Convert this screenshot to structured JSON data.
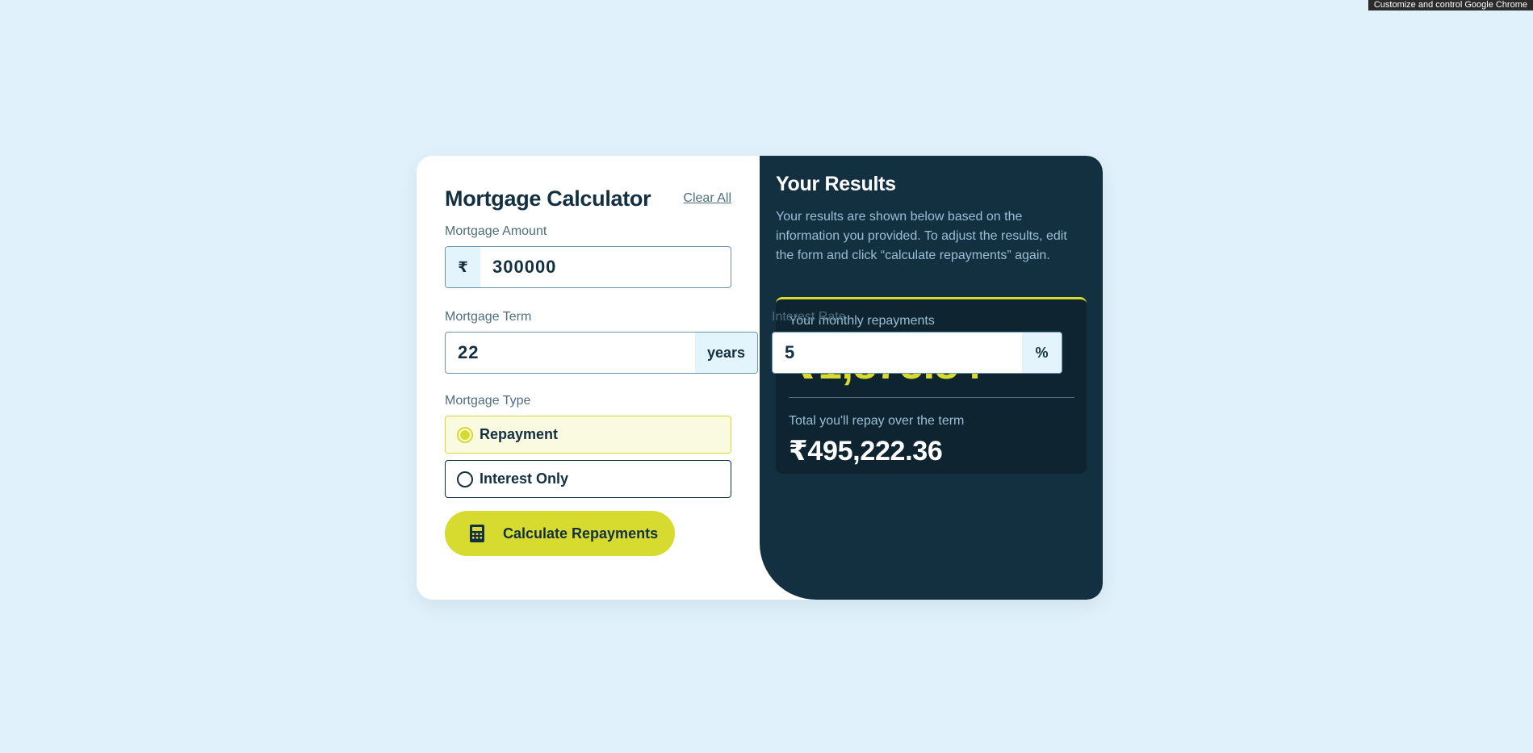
{
  "browser": {
    "tooltip": "Customize and control Google Chrome"
  },
  "form": {
    "title": "Mortgage Calculator",
    "clear_all": "Clear All",
    "amount": {
      "label": "Mortgage Amount",
      "prefix": "₹",
      "value": "300000"
    },
    "term": {
      "label": "Mortgage Term",
      "value": "22",
      "suffix": "years"
    },
    "rate": {
      "label": "Interest Rate",
      "value": "5",
      "suffix": "%"
    },
    "type": {
      "label": "Mortgage Type",
      "options": [
        {
          "label": "Repayment",
          "selected": true
        },
        {
          "label": "Interest Only",
          "selected": false
        }
      ]
    },
    "submit_label": "Calculate Repayments",
    "submit_icon": "calculator-icon"
  },
  "results": {
    "title": "Your Results",
    "description": "Your results are shown below based on the information you provided. To adjust the results, edit the form and click “calculate repayments” again.",
    "monthly_label": "Your monthly repayments",
    "monthly_value": "₹1,875.84",
    "total_label": "Total you'll repay over the term",
    "total_value": "₹495,222.36"
  },
  "colors": {
    "background": "#e0f1fb",
    "slate": "#133041",
    "lime": "#d8db2f",
    "affix_bg": "#e3f4fc"
  }
}
